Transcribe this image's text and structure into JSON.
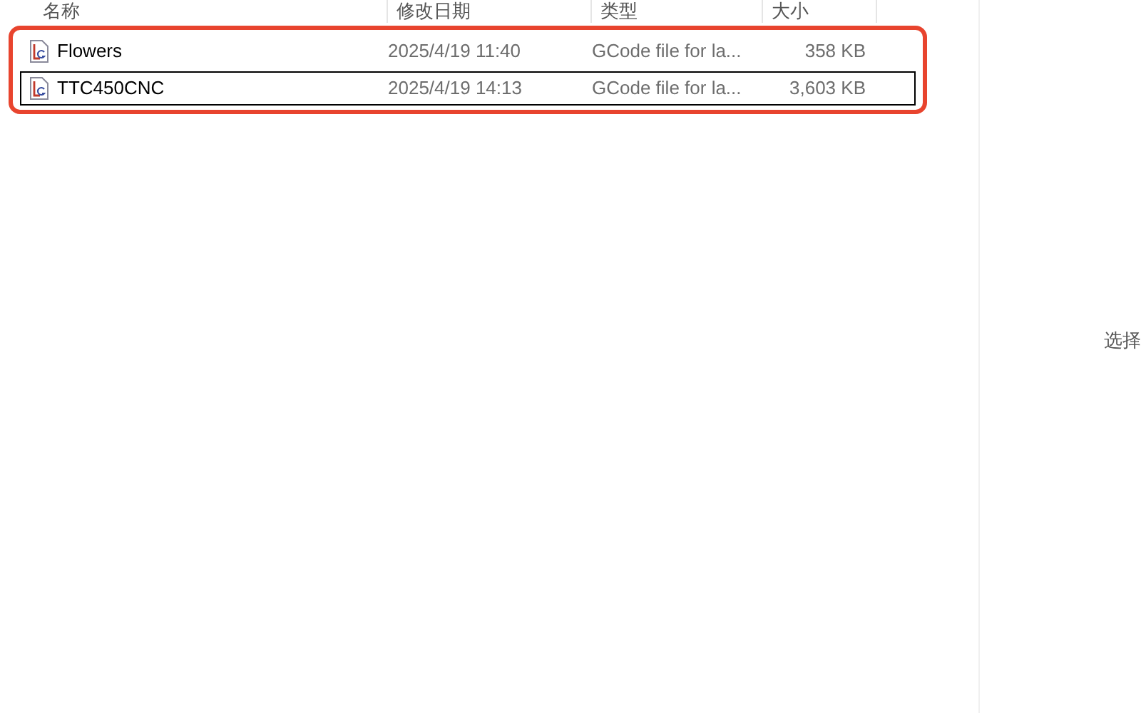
{
  "columns": [
    "名称",
    "修改日期",
    "类型",
    "大小"
  ],
  "rows": [
    {
      "name": "Flowers",
      "modified": "2025/4/19 11:40",
      "type": "GCode file for la...",
      "size": "358 KB",
      "focused": false
    },
    {
      "name": "TTC450CNC",
      "modified": "2025/4/19 14:13",
      "type": "GCode file for la...",
      "size": "3,603 KB",
      "focused": true
    }
  ],
  "preview_pane": {
    "message": "选择"
  }
}
